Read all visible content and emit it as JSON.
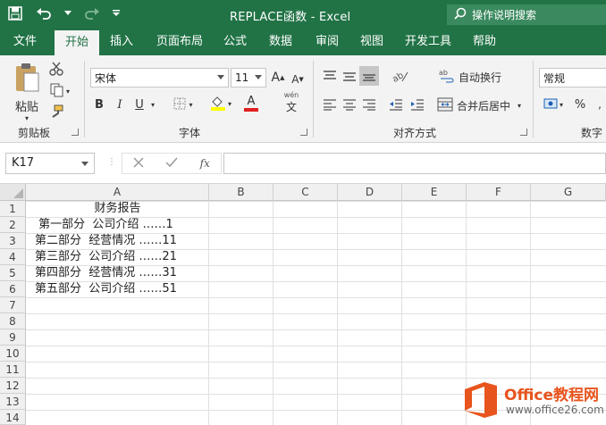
{
  "window": {
    "title": "REPLACE函数  -  Excel"
  },
  "tell_me": {
    "label": "操作说明搜索"
  },
  "tabs": [
    {
      "label": "文件"
    },
    {
      "label": "开始"
    },
    {
      "label": "插入"
    },
    {
      "label": "页面布局"
    },
    {
      "label": "公式"
    },
    {
      "label": "数据"
    },
    {
      "label": "审阅"
    },
    {
      "label": "视图"
    },
    {
      "label": "开发工具"
    },
    {
      "label": "帮助"
    }
  ],
  "ribbon": {
    "clipboard": {
      "paste_label": "粘贴",
      "group_label": "剪贴板"
    },
    "font": {
      "font_name": "宋体",
      "font_size": "11",
      "group_label": "字体",
      "bold": "B",
      "italic": "I",
      "underline": "U",
      "wen": "wén"
    },
    "alignment": {
      "wrap_text": "自动换行",
      "merge_center": "合并后居中",
      "group_label": "对齐方式"
    },
    "number": {
      "format": "常规",
      "percent": "%",
      "group_label": "数字"
    }
  },
  "formula_bar": {
    "name_box": "K17",
    "fx": "fx",
    "formula": ""
  },
  "columns": [
    "A",
    "B",
    "C",
    "D",
    "E",
    "F",
    "G"
  ],
  "rows": [
    "1",
    "2",
    "3",
    "4",
    "5",
    "6",
    "7",
    "8",
    "9",
    "10",
    "11",
    "12",
    "13",
    "14"
  ],
  "cells": {
    "A1": "财务报告",
    "A2": " 第一部分  公司介绍 ……1",
    "A3": "第二部分  经营情况 ……11",
    "A4": "第三部分  公司介绍 ……21",
    "A5": "第四部分  经营情况 ……31",
    "A6": "第五部分  公司介绍 ……51"
  },
  "watermark": {
    "brand": "Office教程网",
    "url": "www.office26.com"
  },
  "colors": {
    "excel_green": "#217346",
    "watermark_orange": "#e8541e"
  }
}
